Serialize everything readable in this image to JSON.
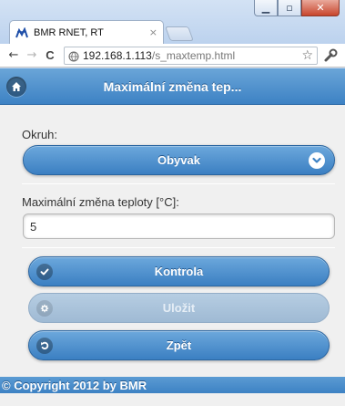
{
  "browser": {
    "tab_title": "BMR RNET, RT",
    "tab_close": "×",
    "url_host": "192.168.1.113",
    "url_path": "/s_maxtemp.html",
    "window_minimize": "▁",
    "window_maximize": "▫",
    "window_close": "✕",
    "back_glyph": "←",
    "forward_glyph": "→",
    "reload_glyph": "C",
    "star_glyph": "☆"
  },
  "header": {
    "title": "Maximální změna tep..."
  },
  "form": {
    "circuit_label": "Okruh:",
    "circuit_value": "Obyvak",
    "max_change_label": "Maximální změna teploty [°C]:",
    "max_change_value": "5"
  },
  "buttons": {
    "check_label": "Kontrola",
    "save_label": "Uložit",
    "back_label": "Zpět"
  },
  "footer": {
    "text": "© Copyright 2012 by BMR"
  },
  "colors": {
    "accent": "#3d82c4",
    "accent_light": "#6ca8dc",
    "disabled": "#a8c1d8",
    "page_bg": "#f0f0f0"
  }
}
